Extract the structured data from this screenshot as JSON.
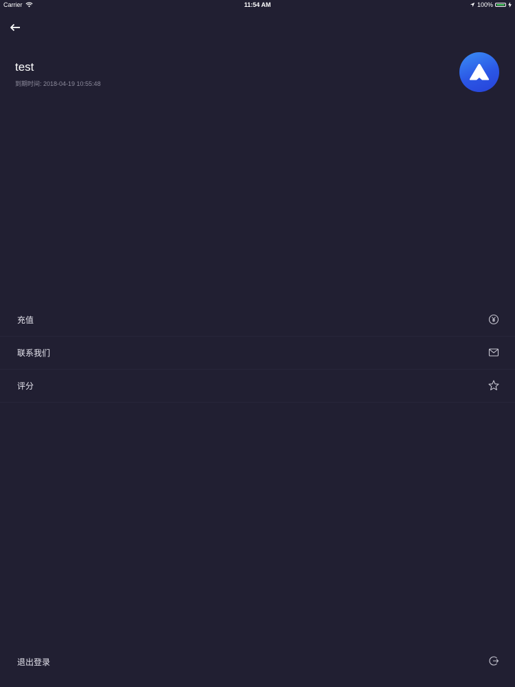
{
  "status_bar": {
    "carrier": "Carrier",
    "time": "11:54 AM",
    "battery": "100%",
    "battery_level": 1.0,
    "battery_color": "#4cd964"
  },
  "header": {
    "back_icon": "arrow-left-icon"
  },
  "profile": {
    "name": "test",
    "expiry": "到期时间: 2018-04-19 10:55:48",
    "avatar_icon": "triangle-logo-icon"
  },
  "menu": {
    "items": [
      {
        "label": "充值",
        "icon": "yuan-circle-icon"
      },
      {
        "label": "联系我们",
        "icon": "mail-icon"
      },
      {
        "label": "评分",
        "icon": "star-icon"
      }
    ]
  },
  "logout": {
    "label": "退出登录",
    "icon": "logout-icon"
  },
  "colors": {
    "background": "#211f32",
    "text": "#ffffff",
    "muted": "#8d8b9c",
    "avatar_gradient_start": "#3b8ef5",
    "avatar_gradient_end": "#2742d8"
  }
}
